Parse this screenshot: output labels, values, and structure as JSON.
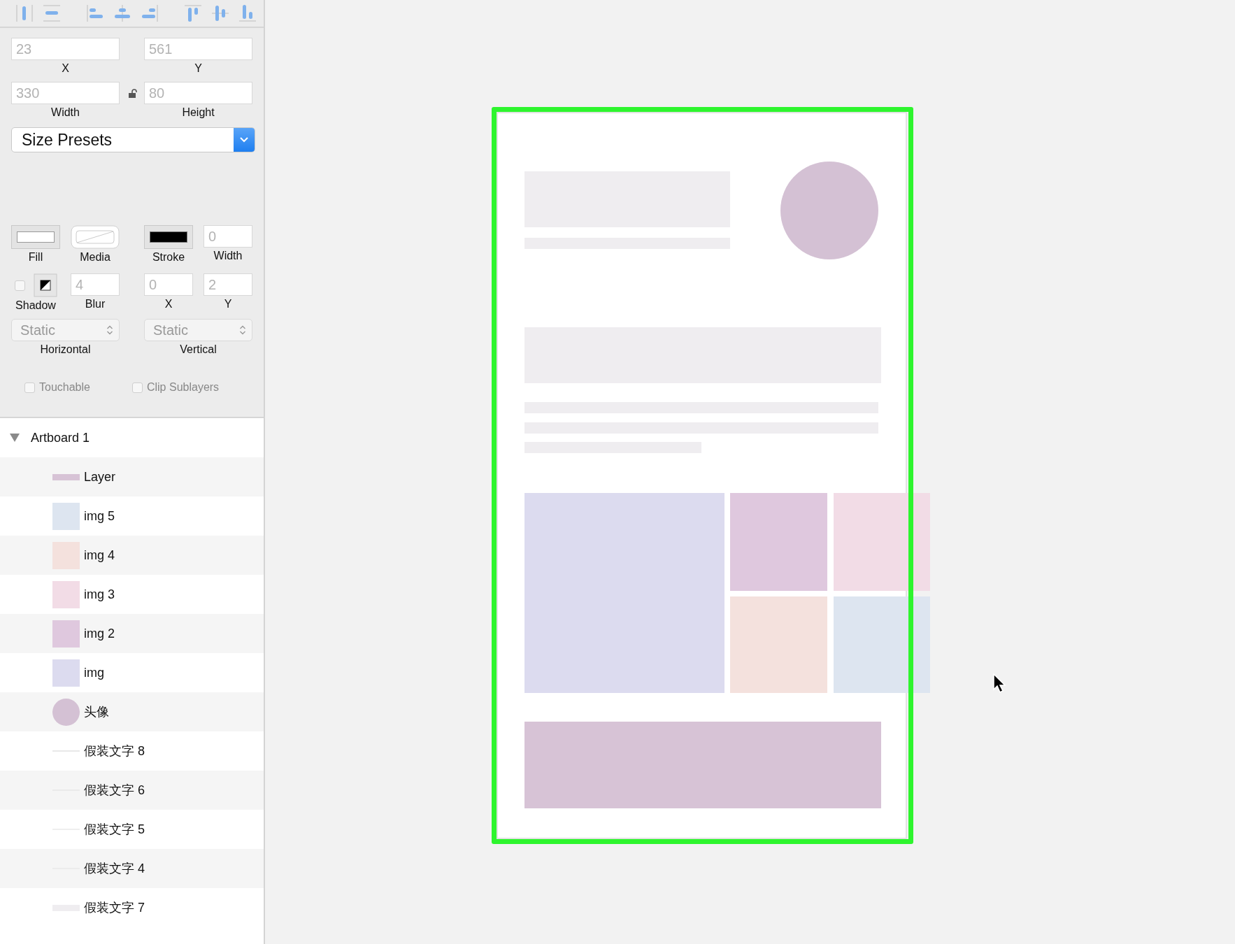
{
  "fields": [
    {
      "label": "X",
      "value": "23",
      "disabled": true
    },
    {
      "label": "Y",
      "value": "561",
      "disabled": true
    },
    {
      "label": "Width",
      "value": "330",
      "disabled": true
    },
    {
      "label": "Height",
      "value": "80",
      "disabled": true
    }
  ],
  "size_lock": {
    "locked": false
  },
  "size_presets": {
    "label": "Size Presets"
  },
  "appearance": {
    "fill_label": "Fill",
    "media_label": "Media",
    "stroke_label": "Stroke",
    "stroke_width": {
      "label": "Width",
      "value": "0",
      "disabled": true
    }
  },
  "shadow": {
    "label": "Shadow",
    "enabled": false,
    "fields": [
      {
        "label": "Blur",
        "value": "4",
        "disabled": true
      },
      {
        "label": "X",
        "value": "0",
        "disabled": true
      },
      {
        "label": "Y",
        "value": "2",
        "disabled": true
      }
    ]
  },
  "layout": [
    {
      "value": "Static",
      "label": "Horizontal"
    },
    {
      "value": "Static",
      "label": "Vertical"
    }
  ],
  "options": [
    {
      "label": "Touchable",
      "checked": false
    },
    {
      "label": "Clip Sublayers",
      "checked": false
    }
  ],
  "layers": {
    "name": "Artboard 1",
    "expanded": true,
    "children": [
      {
        "name": "Layer",
        "kind": "bar",
        "color": "#d7c3d6"
      },
      {
        "name": "img 5",
        "kind": "image",
        "color": "#dde5f0"
      },
      {
        "name": "img 4",
        "kind": "image",
        "color": "#f4e1dd"
      },
      {
        "name": "img 3",
        "kind": "image",
        "color": "#f2dce6"
      },
      {
        "name": "img 2",
        "kind": "image",
        "color": "#dfc8de"
      },
      {
        "name": "img",
        "kind": "image",
        "color": "#dcdbef"
      },
      {
        "name": "头像",
        "kind": "circle",
        "color": "#d4c1d4"
      },
      {
        "name": "假装文字 8",
        "kind": "line",
        "color": "#e8e8e8"
      },
      {
        "name": "假装文字 6",
        "kind": "line",
        "color": "#eaeaea"
      },
      {
        "name": "假装文字 5",
        "kind": "line",
        "color": "#eeeeee"
      },
      {
        "name": "假装文字 4",
        "kind": "line",
        "color": "#ececec"
      },
      {
        "name": "假装文字 7",
        "kind": "bar",
        "color": "#efedf0"
      }
    ]
  }
}
